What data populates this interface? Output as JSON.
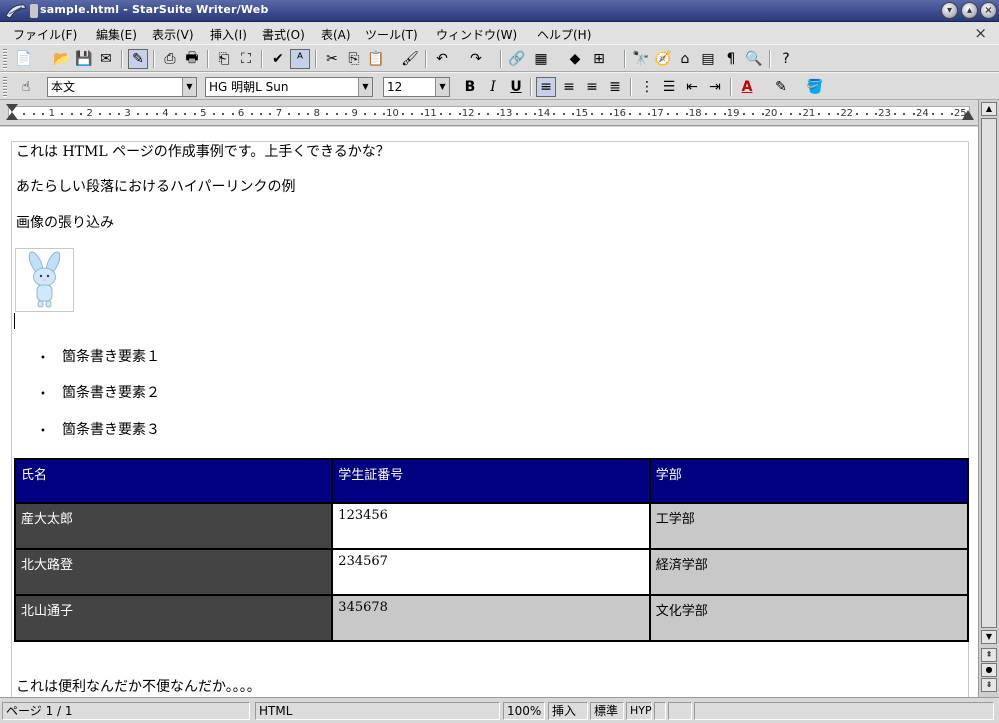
{
  "window": {
    "title": "sample.html - StarSuite Writer/Web"
  },
  "menu": {
    "items": [
      "ファイル(F)",
      "編集(E)",
      "表示(V)",
      "挿入(I)",
      "書式(O)",
      "表(A)",
      "ツール(T)",
      "ウィンドウ(W)",
      "ヘルプ(H)"
    ],
    "close_symbol": "×"
  },
  "format_bar": {
    "paragraph_style": "本文",
    "font_name": "HG 明朝L Sun",
    "font_size": "12",
    "bold_label": "B",
    "italic_label": "I",
    "underline_label": "U"
  },
  "ruler": {
    "labels": [
      "1",
      "2",
      "3",
      "4",
      "5",
      "6",
      "7",
      "8",
      "9",
      "10",
      "11",
      "12",
      "13",
      "14",
      "15",
      "16",
      "17",
      "18",
      "19",
      "20",
      "21",
      "22",
      "23",
      "24",
      "25"
    ]
  },
  "document": {
    "lines": [
      "これは HTML ページの作成事例です。上手くできるかな？",
      "あたらしい段落におけるハイパーリンクの例",
      "画像の張り込み"
    ],
    "bullets": [
      "箇条書き要素１",
      "箇条書き要素２",
      "箇条書き要素３"
    ],
    "table": {
      "headers": [
        "氏名",
        "学生証番号",
        "学部"
      ],
      "rows": [
        [
          "産大太郎",
          "123456",
          "工学部"
        ],
        [
          "北大路登",
          "234567",
          "経済学部"
        ],
        [
          "北山通子",
          "345678",
          "文化学部"
        ]
      ]
    },
    "footer_line": "これは便利なんだか不便なんだか。。。。",
    "colors": {
      "header_bg": "#000080",
      "name_col_bg": "#444444",
      "dept_col_bg": "#c8c8c8"
    }
  },
  "status": {
    "page": "ページ 1 / 1",
    "mode": "HTML",
    "zoom": "100%",
    "insert": "挿入",
    "selection": "標準",
    "hyperlink": "HYP"
  }
}
